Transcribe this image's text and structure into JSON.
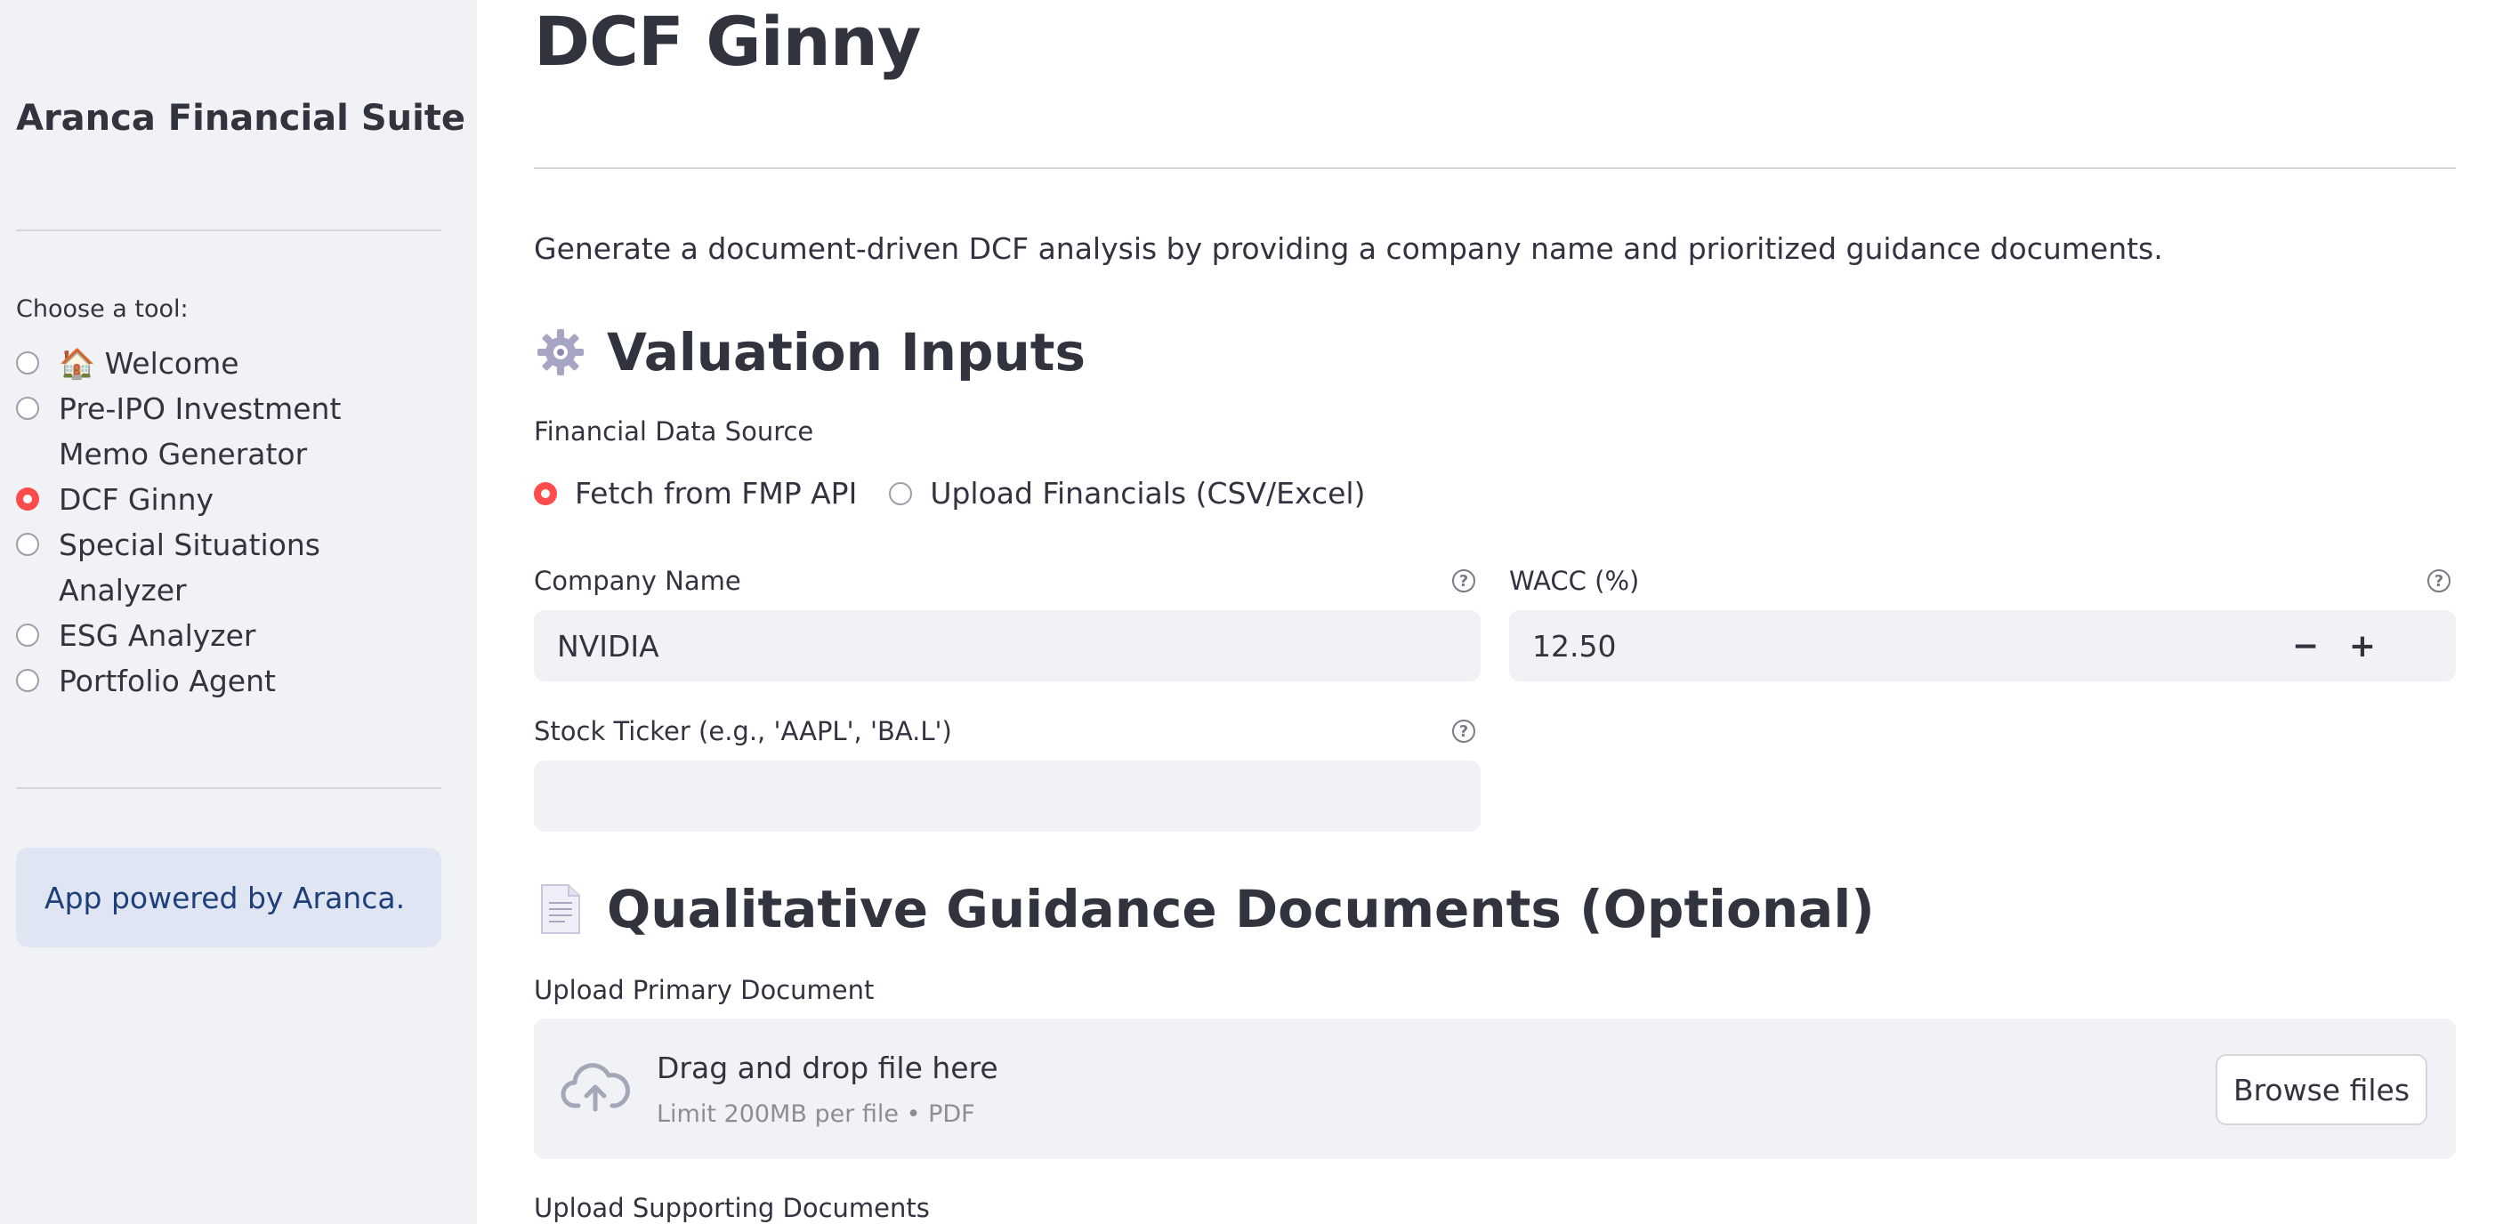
{
  "sidebar": {
    "title": "Aranca Financial Suite",
    "choose_label": "Choose a tool:",
    "tools": [
      {
        "label": "🏠 Welcome",
        "selected": false
      },
      {
        "label": "Pre-IPO Investment Memo Generator",
        "selected": false
      },
      {
        "label": "DCF Ginny",
        "selected": true
      },
      {
        "label": "Special Situations Analyzer",
        "selected": false
      },
      {
        "label": "ESG Analyzer",
        "selected": false
      },
      {
        "label": "Portfolio Agent",
        "selected": false
      }
    ],
    "powered_by": "App powered by Aranca."
  },
  "main": {
    "title": "DCF Ginny",
    "description": "Generate a document-driven DCF analysis by providing a company name and prioritized guidance documents.",
    "valuation": {
      "heading": "Valuation Inputs",
      "icon": "gear-icon",
      "source_label": "Financial Data Source",
      "source_options": [
        {
          "label": "Fetch from FMP API",
          "selected": true
        },
        {
          "label": "Upload Financials (CSV/Excel)",
          "selected": false
        }
      ],
      "company_label": "Company Name",
      "company_value": "NVIDIA",
      "wacc_label": "WACC (%)",
      "wacc_value": "12.50",
      "minus": "−",
      "plus": "+",
      "ticker_label": "Stock Ticker (e.g., 'AAPL', 'BA.L')",
      "ticker_value": ""
    },
    "guidance": {
      "heading": "Qualitative Guidance Documents (Optional)",
      "icon": "document-icon",
      "primary_label": "Upload Primary Document",
      "drop_text": "Drag and drop file here",
      "limit_text": "Limit 200MB per file • PDF",
      "browse_label": "Browse files",
      "supporting_label": "Upload Supporting Documents"
    }
  },
  "colors": {
    "accent": "#ff4b4b",
    "sidebar_bg": "#f0f2f6",
    "info_bg": "#dfe5f2",
    "info_text": "#1f3f7a",
    "text": "#31333f"
  }
}
